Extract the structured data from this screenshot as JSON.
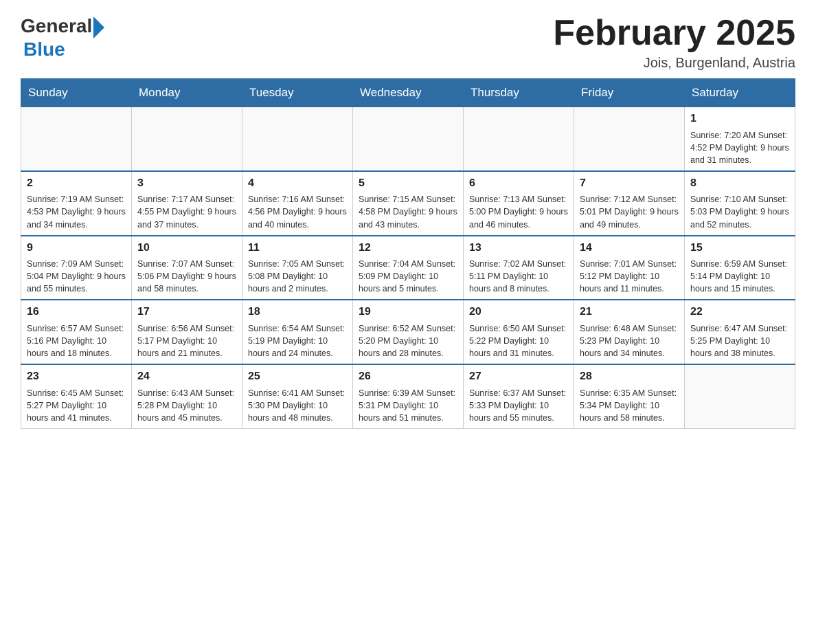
{
  "logo": {
    "general": "General",
    "blue": "Blue"
  },
  "header": {
    "title": "February 2025",
    "subtitle": "Jois, Burgenland, Austria"
  },
  "weekdays": [
    "Sunday",
    "Monday",
    "Tuesday",
    "Wednesday",
    "Thursday",
    "Friday",
    "Saturday"
  ],
  "weeks": [
    [
      {
        "num": "",
        "info": ""
      },
      {
        "num": "",
        "info": ""
      },
      {
        "num": "",
        "info": ""
      },
      {
        "num": "",
        "info": ""
      },
      {
        "num": "",
        "info": ""
      },
      {
        "num": "",
        "info": ""
      },
      {
        "num": "1",
        "info": "Sunrise: 7:20 AM\nSunset: 4:52 PM\nDaylight: 9 hours and 31 minutes."
      }
    ],
    [
      {
        "num": "2",
        "info": "Sunrise: 7:19 AM\nSunset: 4:53 PM\nDaylight: 9 hours and 34 minutes."
      },
      {
        "num": "3",
        "info": "Sunrise: 7:17 AM\nSunset: 4:55 PM\nDaylight: 9 hours and 37 minutes."
      },
      {
        "num": "4",
        "info": "Sunrise: 7:16 AM\nSunset: 4:56 PM\nDaylight: 9 hours and 40 minutes."
      },
      {
        "num": "5",
        "info": "Sunrise: 7:15 AM\nSunset: 4:58 PM\nDaylight: 9 hours and 43 minutes."
      },
      {
        "num": "6",
        "info": "Sunrise: 7:13 AM\nSunset: 5:00 PM\nDaylight: 9 hours and 46 minutes."
      },
      {
        "num": "7",
        "info": "Sunrise: 7:12 AM\nSunset: 5:01 PM\nDaylight: 9 hours and 49 minutes."
      },
      {
        "num": "8",
        "info": "Sunrise: 7:10 AM\nSunset: 5:03 PM\nDaylight: 9 hours and 52 minutes."
      }
    ],
    [
      {
        "num": "9",
        "info": "Sunrise: 7:09 AM\nSunset: 5:04 PM\nDaylight: 9 hours and 55 minutes."
      },
      {
        "num": "10",
        "info": "Sunrise: 7:07 AM\nSunset: 5:06 PM\nDaylight: 9 hours and 58 minutes."
      },
      {
        "num": "11",
        "info": "Sunrise: 7:05 AM\nSunset: 5:08 PM\nDaylight: 10 hours and 2 minutes."
      },
      {
        "num": "12",
        "info": "Sunrise: 7:04 AM\nSunset: 5:09 PM\nDaylight: 10 hours and 5 minutes."
      },
      {
        "num": "13",
        "info": "Sunrise: 7:02 AM\nSunset: 5:11 PM\nDaylight: 10 hours and 8 minutes."
      },
      {
        "num": "14",
        "info": "Sunrise: 7:01 AM\nSunset: 5:12 PM\nDaylight: 10 hours and 11 minutes."
      },
      {
        "num": "15",
        "info": "Sunrise: 6:59 AM\nSunset: 5:14 PM\nDaylight: 10 hours and 15 minutes."
      }
    ],
    [
      {
        "num": "16",
        "info": "Sunrise: 6:57 AM\nSunset: 5:16 PM\nDaylight: 10 hours and 18 minutes."
      },
      {
        "num": "17",
        "info": "Sunrise: 6:56 AM\nSunset: 5:17 PM\nDaylight: 10 hours and 21 minutes."
      },
      {
        "num": "18",
        "info": "Sunrise: 6:54 AM\nSunset: 5:19 PM\nDaylight: 10 hours and 24 minutes."
      },
      {
        "num": "19",
        "info": "Sunrise: 6:52 AM\nSunset: 5:20 PM\nDaylight: 10 hours and 28 minutes."
      },
      {
        "num": "20",
        "info": "Sunrise: 6:50 AM\nSunset: 5:22 PM\nDaylight: 10 hours and 31 minutes."
      },
      {
        "num": "21",
        "info": "Sunrise: 6:48 AM\nSunset: 5:23 PM\nDaylight: 10 hours and 34 minutes."
      },
      {
        "num": "22",
        "info": "Sunrise: 6:47 AM\nSunset: 5:25 PM\nDaylight: 10 hours and 38 minutes."
      }
    ],
    [
      {
        "num": "23",
        "info": "Sunrise: 6:45 AM\nSunset: 5:27 PM\nDaylight: 10 hours and 41 minutes."
      },
      {
        "num": "24",
        "info": "Sunrise: 6:43 AM\nSunset: 5:28 PM\nDaylight: 10 hours and 45 minutes."
      },
      {
        "num": "25",
        "info": "Sunrise: 6:41 AM\nSunset: 5:30 PM\nDaylight: 10 hours and 48 minutes."
      },
      {
        "num": "26",
        "info": "Sunrise: 6:39 AM\nSunset: 5:31 PM\nDaylight: 10 hours and 51 minutes."
      },
      {
        "num": "27",
        "info": "Sunrise: 6:37 AM\nSunset: 5:33 PM\nDaylight: 10 hours and 55 minutes."
      },
      {
        "num": "28",
        "info": "Sunrise: 6:35 AM\nSunset: 5:34 PM\nDaylight: 10 hours and 58 minutes."
      },
      {
        "num": "",
        "info": ""
      }
    ]
  ]
}
